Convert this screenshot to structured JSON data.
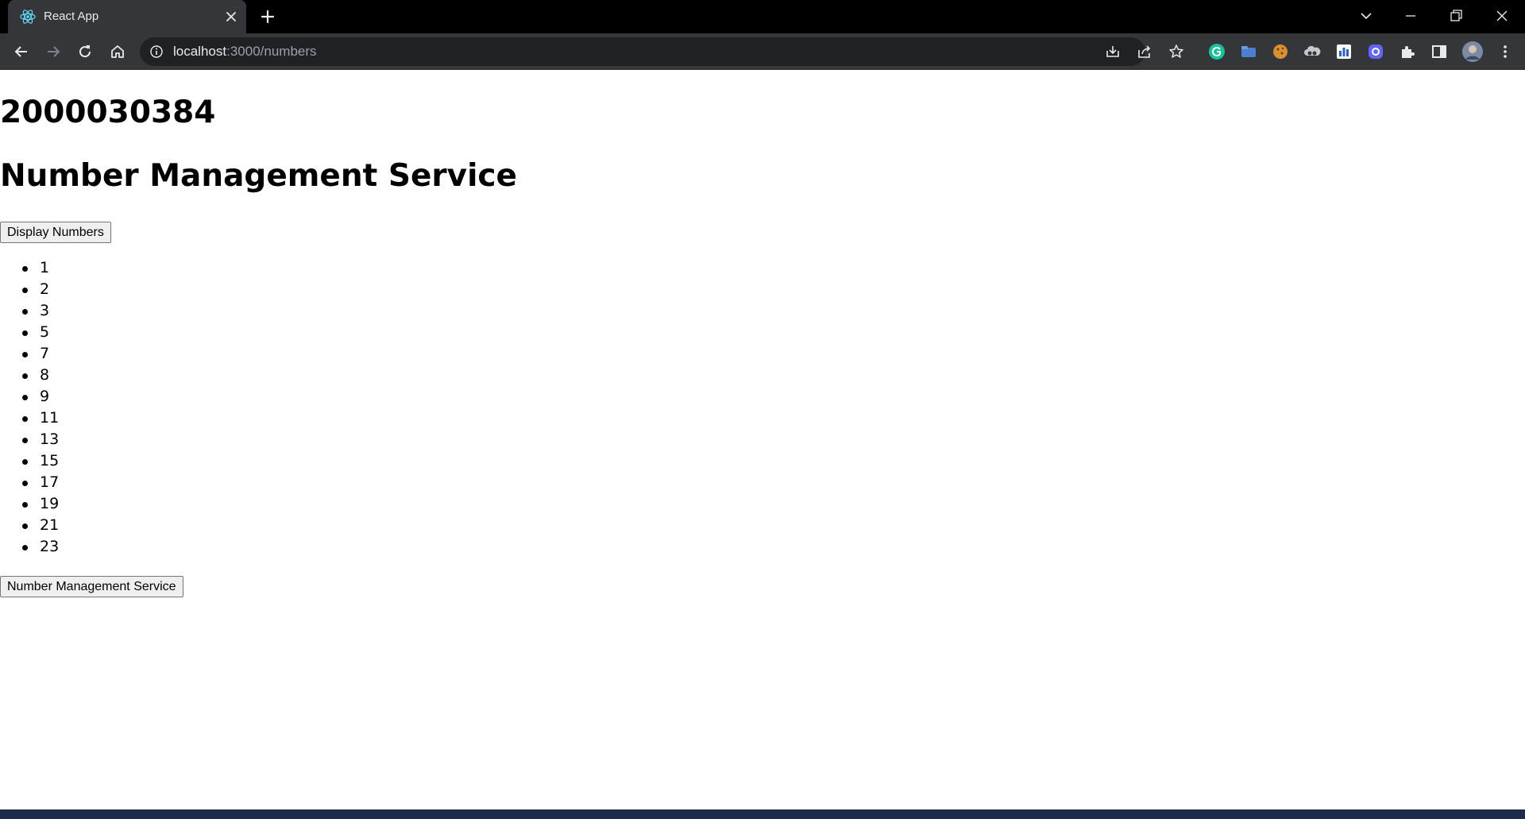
{
  "browser": {
    "tab": {
      "title": "React App",
      "favicon": "react-icon"
    },
    "address_bar": {
      "host": "localhost",
      "path": ":3000/numbers"
    },
    "nav_icons": [
      "back-arrow-icon",
      "forward-arrow-icon",
      "reload-icon",
      "home-icon"
    ],
    "omnibox_actions": [
      "install-app-icon",
      "share-icon",
      "bookmark-star-icon"
    ],
    "extensions": [
      "grammarly-icon",
      "folder-extension-icon",
      "cookie-icon",
      "cloud-extension-icon",
      "chart-extension-icon",
      "mastodon-icon",
      "puzzle-piece-icon",
      "side-panel-icon",
      "profile-avatar-icon",
      "more-menu-icon"
    ],
    "window_controls": [
      "tab-search-icon",
      "minimize-icon",
      "restore-icon",
      "close-window-icon"
    ],
    "colors": {
      "tabstrip": "#000000",
      "toolbar": "#35363a",
      "omnibox": "#202124",
      "text": "#e8eaed",
      "muted": "#9aa0a6"
    }
  },
  "page": {
    "id_heading": "2000030384",
    "title": "Number Management Service",
    "display_button": "Display Numbers",
    "numbers": [
      "1",
      "2",
      "3",
      "5",
      "7",
      "8",
      "9",
      "11",
      "13",
      "15",
      "17",
      "19",
      "21",
      "23"
    ],
    "bottom_button": "Number Management Service"
  }
}
